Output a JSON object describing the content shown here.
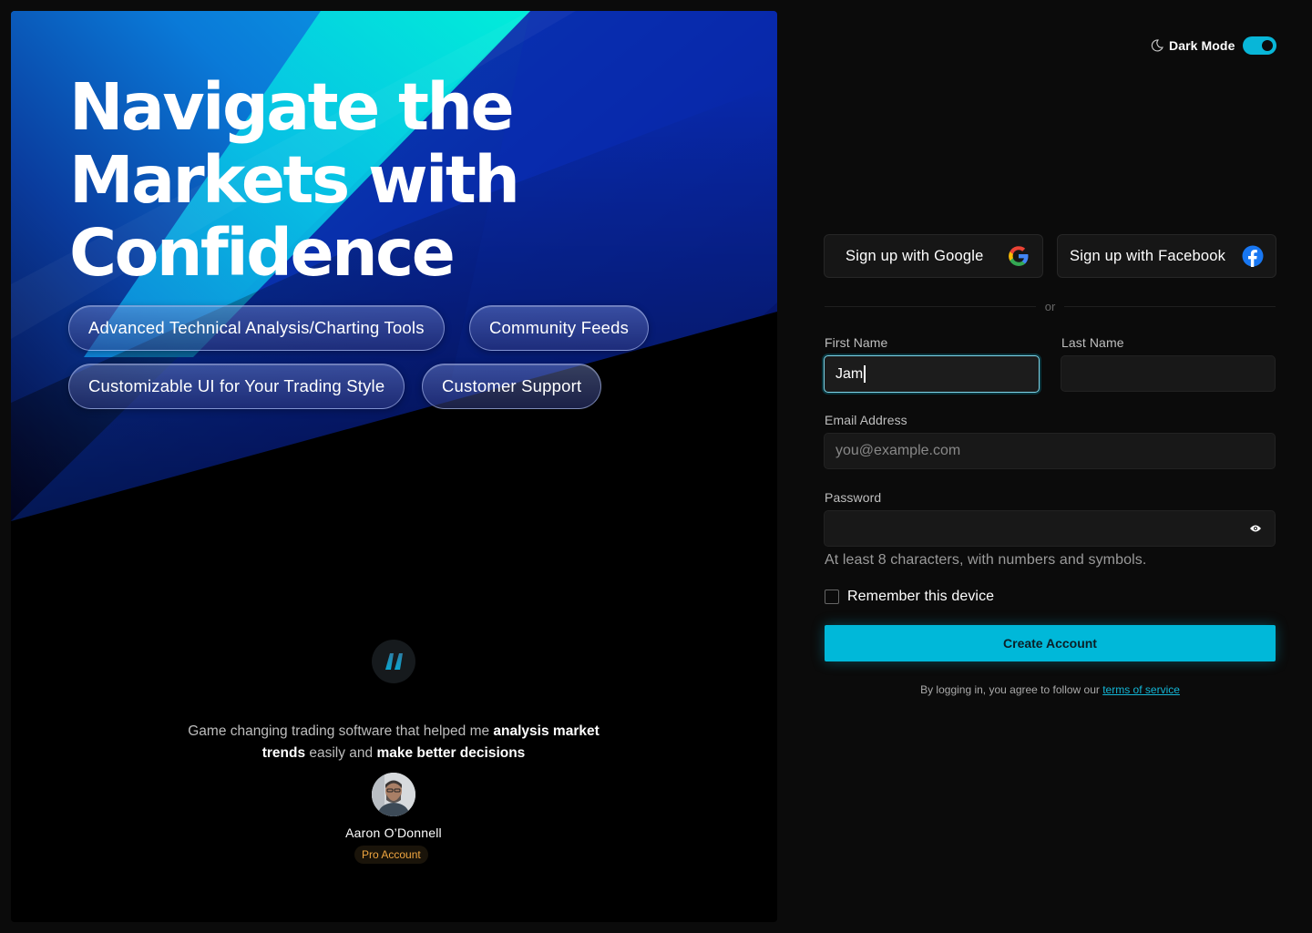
{
  "hero": {
    "title_line1": "Navigate the",
    "title_line2": "Markets with",
    "title_line3": "Confidence",
    "features": [
      "Advanced Technical Analysis/Charting Tools",
      "Community Feeds",
      "Customizable UI for Your Trading Style",
      "Customer Support"
    ],
    "testimonial": {
      "part1": "Game changing trading software that helped me ",
      "bold1": "analysis market trends",
      "part2": " easily and ",
      "bold2": "make better decisions",
      "author": "Aaron O’Donnell",
      "badge": "Pro Account"
    }
  },
  "header": {
    "dark_mode_label": "Dark Mode",
    "dark_mode_on": true
  },
  "social": {
    "google_label": "Sign up with Google",
    "facebook_label": "Sign up with Facebook"
  },
  "divider": {
    "text": "or"
  },
  "form": {
    "first_name": {
      "label": "First Name",
      "value": "Jam"
    },
    "last_name": {
      "label": "Last Name",
      "value": ""
    },
    "email": {
      "label": "Email Address",
      "placeholder": "you@example.com"
    },
    "password": {
      "label": "Password",
      "value": ""
    },
    "password_hint": "At least 8 characters, with numbers and symbols.",
    "remember_label": "Remember this device",
    "remember_checked": false,
    "submit_label": "Create Account",
    "legal_text": "By logging in, you agree to follow our ",
    "legal_link": "terms of service"
  },
  "colors": {
    "accent": "#00b8d9",
    "background": "#0b0b0b",
    "badge_text": "#f0a640"
  }
}
